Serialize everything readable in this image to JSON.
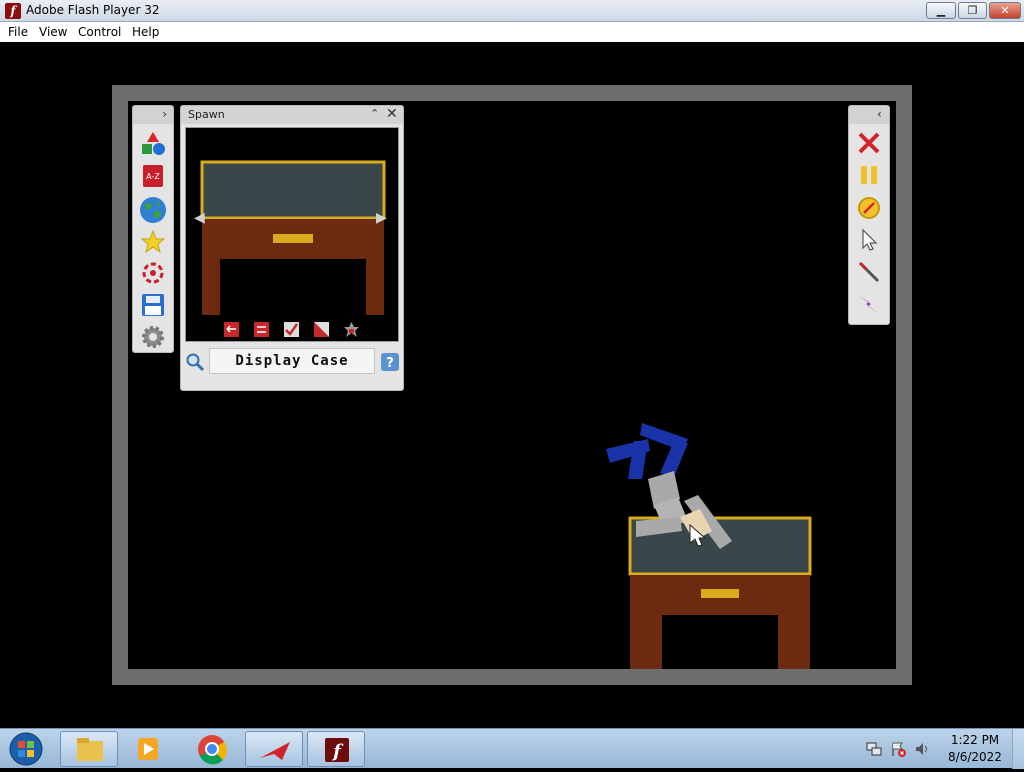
{
  "window": {
    "title": "Adobe Flash Player 32",
    "minimize_symbol": "▁",
    "maximize_symbol": "❐",
    "close_symbol": "✕",
    "app_icon_glyph": "f"
  },
  "menu": {
    "items": [
      "File",
      "View",
      "Control",
      "Help"
    ]
  },
  "left_strip": {
    "expand_symbol": "›",
    "tools": [
      {
        "name": "shapes-tool-icon"
      },
      {
        "name": "alphabetical-list-icon"
      },
      {
        "name": "world-globe-icon"
      },
      {
        "name": "favorites-star-icon"
      },
      {
        "name": "target-crosshair-icon"
      },
      {
        "name": "save-disk-icon"
      },
      {
        "name": "settings-gear-icon"
      }
    ]
  },
  "spawn_panel": {
    "title": "Spawn",
    "collapse_symbol": "⌃",
    "close_symbol": "✕",
    "prev_arrow": "◀",
    "next_arrow": "▶",
    "item_name": "Display Case",
    "object_tools": [
      {
        "name": "flip-horizontal-icon"
      },
      {
        "name": "swap-options-icon"
      },
      {
        "name": "check-toggle-icon"
      },
      {
        "name": "color-fill-icon"
      },
      {
        "name": "lock-badge-icon"
      }
    ]
  },
  "right_strip": {
    "collapse_symbol": "‹",
    "tools": [
      {
        "name": "delete-x-icon"
      },
      {
        "name": "pause-icon"
      },
      {
        "name": "compass-icon"
      },
      {
        "name": "pointer-cursor-icon"
      },
      {
        "name": "magic-wand-icon"
      },
      {
        "name": "lightning-bolt-icon"
      }
    ]
  },
  "taskbar": {
    "clock_time": "1:22 PM",
    "clock_date": "8/6/2022"
  }
}
